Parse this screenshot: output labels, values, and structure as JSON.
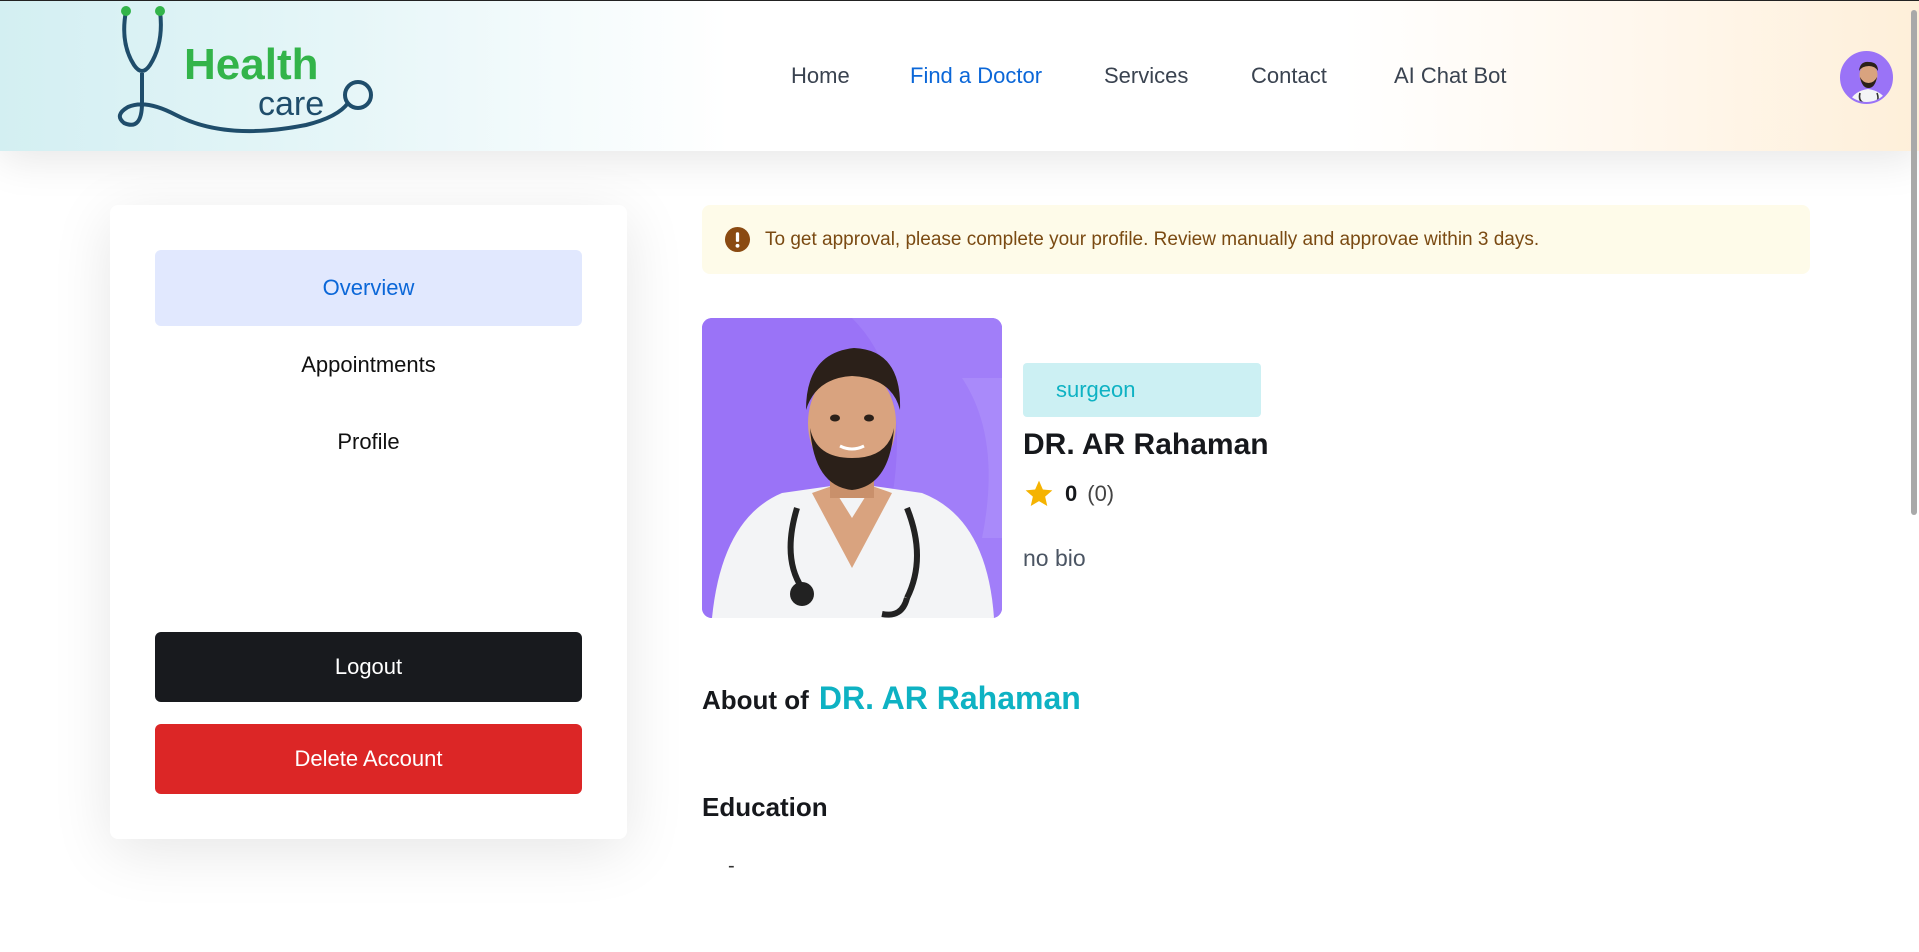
{
  "brand": {
    "logo_line1": "Health",
    "logo_line2": "care"
  },
  "nav": {
    "items": [
      {
        "label": "Home",
        "active": false
      },
      {
        "label": "Find a Doctor",
        "active": true
      },
      {
        "label": "Services",
        "active": false
      },
      {
        "label": "Contact",
        "active": false
      },
      {
        "label": "AI Chat Bot",
        "active": false
      }
    ]
  },
  "sidebar": {
    "tabs": [
      {
        "label": "Overview",
        "active": true
      },
      {
        "label": "Appointments",
        "active": false
      },
      {
        "label": "Profile",
        "active": false
      }
    ],
    "logout_label": "Logout",
    "delete_label": "Delete Account"
  },
  "alert": {
    "icon": "exclamation-circle-icon",
    "message": "To get approval, please complete your profile. Review manually and approvae within 3 days."
  },
  "doctor": {
    "specialty": "surgeon",
    "name": "DR. AR Rahaman",
    "avg_rating": "0",
    "total_rating": "(0)",
    "bio": "no bio"
  },
  "about": {
    "prefix": "About of",
    "name": "DR. AR Rahaman"
  },
  "education": {
    "title": "Education",
    "placeholder": "-"
  },
  "colors": {
    "accent_blue": "#0b67d8",
    "teal": "#0eb2c3",
    "photo_bg": "#9a73f7",
    "danger": "#dc2626",
    "dark": "#181a1e",
    "alert_bg": "#fefbe9"
  }
}
